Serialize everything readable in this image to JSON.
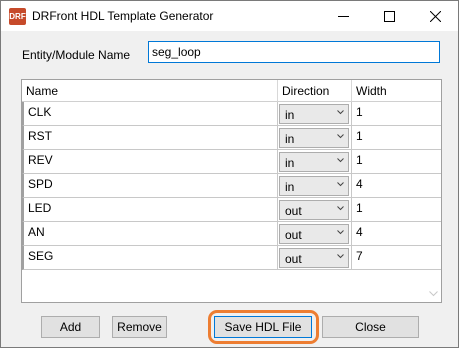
{
  "window": {
    "title": "DRFront HDL Template Generator",
    "app_icon_text": "DRF",
    "controls": [
      "minimize",
      "maximize",
      "close"
    ]
  },
  "entity": {
    "label": "Entity/Module Name",
    "value": "seg_loop"
  },
  "grid": {
    "columns": [
      "Name",
      "Direction",
      "Width"
    ],
    "rows": [
      {
        "name": "CLK",
        "direction": "in",
        "width": "1"
      },
      {
        "name": "RST",
        "direction": "in",
        "width": "1"
      },
      {
        "name": "REV",
        "direction": "in",
        "width": "1"
      },
      {
        "name": "SPD",
        "direction": "in",
        "width": "4"
      },
      {
        "name": "LED",
        "direction": "out",
        "width": "1"
      },
      {
        "name": "AN",
        "direction": "out",
        "width": "4"
      },
      {
        "name": "SEG",
        "direction": "out",
        "width": "7"
      }
    ]
  },
  "buttons": {
    "add": "Add",
    "remove": "Remove",
    "save": "Save HDL File",
    "close": "Close"
  },
  "colors": {
    "highlight": "#ed7d31",
    "focus": "#0078d7"
  }
}
